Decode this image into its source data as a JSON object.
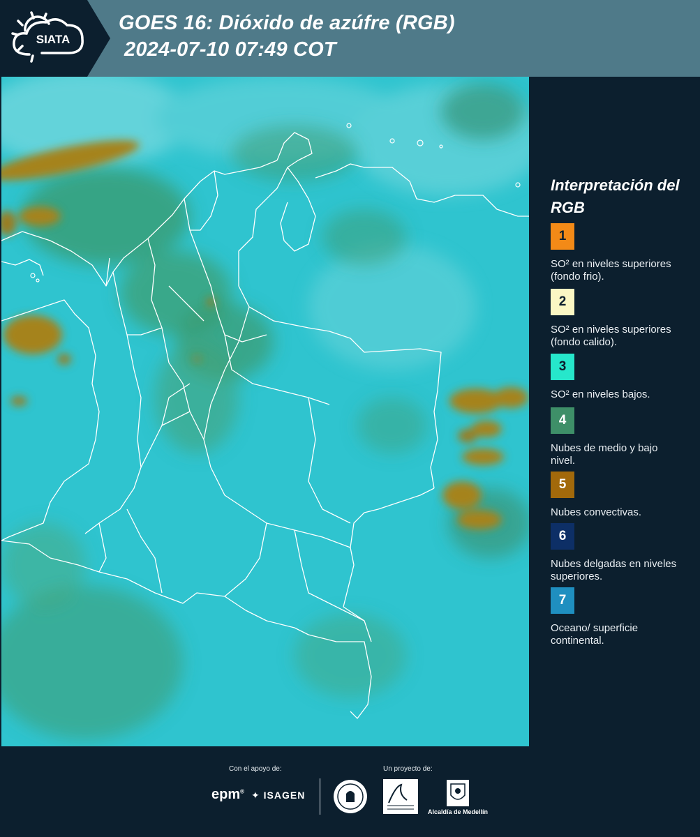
{
  "header": {
    "title_line1": "GOES 16: Dióxido de azúfre (RGB)",
    "title_line2": "2024-07-10 07:49 COT",
    "logo_text": "SIATA",
    "logo_icon": "sun-cloud-icon"
  },
  "map": {
    "background_color": "#2fc4cf",
    "border_color": "#ffffff",
    "convective_color": "#a5831f",
    "cloud_green": "#3b9a6e"
  },
  "legend": {
    "title": "Interpretación del RGB",
    "items": [
      {
        "number": "1",
        "color": "#f38a17",
        "text_color": "#0c1f2e",
        "text": "SO² en niveles superiores (fondo frio)."
      },
      {
        "number": "2",
        "color": "#fbf7c4",
        "text_color": "#0c1f2e",
        "text": "SO² en niveles superiores (fondo calido)."
      },
      {
        "number": "3",
        "color": "#26e7cb",
        "text_color": "#0c1f2e",
        "text": "SO² en niveles bajos."
      },
      {
        "number": "4",
        "color": "#3e8f68",
        "text_color": "#ffffff",
        "text": "Nubes de medio y bajo nivel."
      },
      {
        "number": "5",
        "color": "#a2690b",
        "text_color": "#ffffff",
        "text": "Nubes convectivas."
      },
      {
        "number": "6",
        "color": "#0d2f66",
        "text_color": "#ffffff",
        "text": "Nubes delgadas en niveles superiores."
      },
      {
        "number": "7",
        "color": "#1f8fc0",
        "text_color": "#ffffff",
        "text": "Oceano/ superficie continental."
      }
    ]
  },
  "footer": {
    "support_label": "Con el apoyo de:",
    "project_label": "Un proyecto de:",
    "sponsors": [
      "epm",
      "ISAGEN"
    ],
    "partners": [
      "Área Metropolitana Valle de Aburrá",
      "Alcaldía de Medellín"
    ],
    "alcaldia_label": "Alcaldía de Medellín"
  }
}
